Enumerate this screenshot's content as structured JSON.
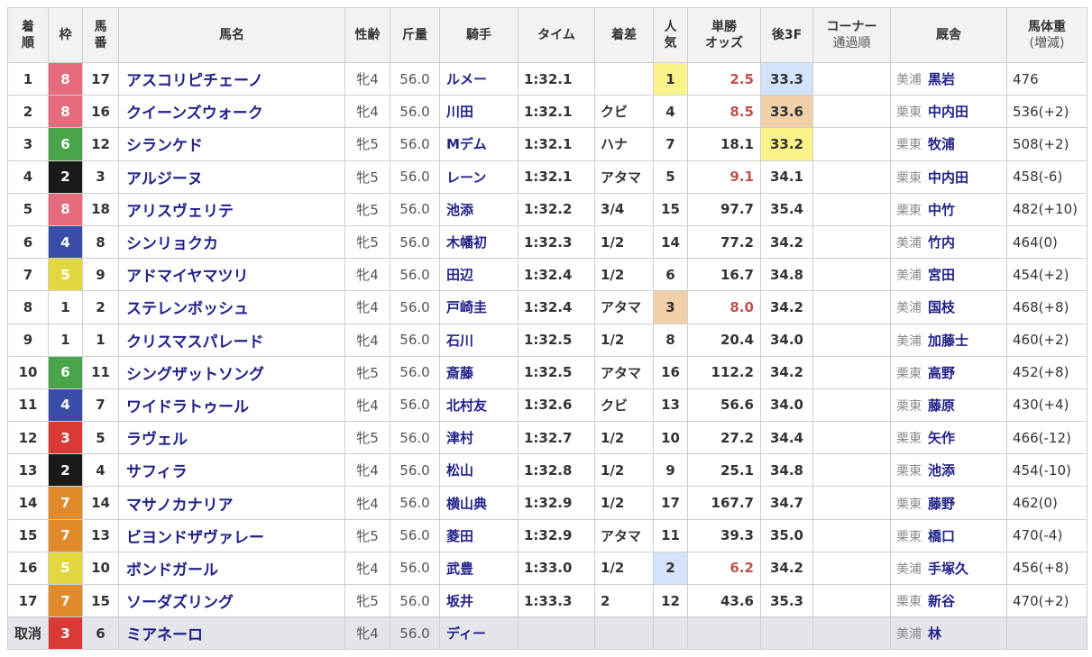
{
  "headers": {
    "rank": [
      "着",
      "順"
    ],
    "waku": "枠",
    "num": [
      "馬",
      "番"
    ],
    "name": "馬名",
    "age": "性齢",
    "weight": "斤量",
    "jockey": "騎手",
    "time": "タイム",
    "margin": "着差",
    "pop": [
      "人",
      "気"
    ],
    "odds": [
      "単勝",
      "オッズ"
    ],
    "last3f": "後3F",
    "corner": [
      "コーナー",
      "通過順"
    ],
    "stable": "厩舎",
    "bodyweight": [
      "馬体重",
      "(増減)"
    ]
  },
  "colors": {
    "waku": {
      "1": {
        "bg": "#ffffff",
        "fg": "#333333"
      },
      "2": {
        "bg": "#1a1a1a",
        "fg": "#ffffff"
      },
      "3": {
        "bg": "#d93a36",
        "fg": "#ffffff"
      },
      "4": {
        "bg": "#3b4ba8",
        "fg": "#ffffff"
      },
      "5": {
        "bg": "#e2d741",
        "fg": "#ffffff"
      },
      "6": {
        "bg": "#4aa54a",
        "fg": "#ffffff"
      },
      "7": {
        "bg": "#e08a2c",
        "fg": "#ffffff"
      },
      "8": {
        "bg": "#e56b7d",
        "fg": "#ffffff"
      }
    },
    "highlight1": "#faf38a",
    "highlight2": "#d4e2fb",
    "highlight3": "#f1cfa8"
  },
  "rows": [
    {
      "rank": "1",
      "waku": "8",
      "num": "17",
      "name": "アスコリピチェーノ",
      "age": "牝4",
      "weight": "56.0",
      "jockey": "ルメー",
      "time": "1:32.1",
      "margin": "",
      "pop": "1",
      "odds": "2.5",
      "last3f": "33.3",
      "corner": "",
      "area": "美浦",
      "trainer": "黒岩",
      "bw": "476",
      "oddsRed": true,
      "popHl": "1",
      "l3Hl": "2"
    },
    {
      "rank": "2",
      "waku": "8",
      "num": "16",
      "name": "クイーンズウォーク",
      "age": "牝4",
      "weight": "56.0",
      "jockey": "川田",
      "time": "1:32.1",
      "margin": "クビ",
      "pop": "4",
      "odds": "8.5",
      "last3f": "33.6",
      "corner": "",
      "area": "栗東",
      "trainer": "中内田",
      "bw": "536(+2)",
      "oddsRed": true,
      "popHl": "",
      "l3Hl": "3"
    },
    {
      "rank": "3",
      "waku": "6",
      "num": "12",
      "name": "シランケド",
      "age": "牝5",
      "weight": "56.0",
      "jockey": "Mデム",
      "time": "1:32.1",
      "margin": "ハナ",
      "pop": "7",
      "odds": "18.1",
      "last3f": "33.2",
      "corner": "",
      "area": "栗東",
      "trainer": "牧浦",
      "bw": "508(+2)",
      "oddsRed": false,
      "popHl": "",
      "l3Hl": "1"
    },
    {
      "rank": "4",
      "waku": "2",
      "num": "3",
      "name": "アルジーヌ",
      "age": "牝5",
      "weight": "56.0",
      "jockey": "レーン",
      "time": "1:32.1",
      "margin": "アタマ",
      "pop": "5",
      "odds": "9.1",
      "last3f": "34.1",
      "corner": "",
      "area": "栗東",
      "trainer": "中内田",
      "bw": "458(-6)",
      "oddsRed": true,
      "popHl": "",
      "l3Hl": ""
    },
    {
      "rank": "5",
      "waku": "8",
      "num": "18",
      "name": "アリスヴェリテ",
      "age": "牝5",
      "weight": "56.0",
      "jockey": "池添",
      "time": "1:32.2",
      "margin": "3/4",
      "pop": "15",
      "odds": "97.7",
      "last3f": "35.4",
      "corner": "",
      "area": "栗東",
      "trainer": "中竹",
      "bw": "482(+10)",
      "oddsRed": false,
      "popHl": "",
      "l3Hl": ""
    },
    {
      "rank": "6",
      "waku": "4",
      "num": "8",
      "name": "シンリョクカ",
      "age": "牝5",
      "weight": "56.0",
      "jockey": "木幡初",
      "time": "1:32.3",
      "margin": "1/2",
      "pop": "14",
      "odds": "77.2",
      "last3f": "34.2",
      "corner": "",
      "area": "美浦",
      "trainer": "竹内",
      "bw": "464(0)",
      "oddsRed": false,
      "popHl": "",
      "l3Hl": ""
    },
    {
      "rank": "7",
      "waku": "5",
      "num": "9",
      "name": "アドマイヤマツリ",
      "age": "牝4",
      "weight": "56.0",
      "jockey": "田辺",
      "time": "1:32.4",
      "margin": "1/2",
      "pop": "6",
      "odds": "16.7",
      "last3f": "34.8",
      "corner": "",
      "area": "美浦",
      "trainer": "宮田",
      "bw": "454(+2)",
      "oddsRed": false,
      "popHl": "",
      "l3Hl": ""
    },
    {
      "rank": "8",
      "waku": "1",
      "num": "2",
      "name": "ステレンボッシュ",
      "age": "牝4",
      "weight": "56.0",
      "jockey": "戸崎圭",
      "time": "1:32.4",
      "margin": "アタマ",
      "pop": "3",
      "odds": "8.0",
      "last3f": "34.2",
      "corner": "",
      "area": "美浦",
      "trainer": "国枝",
      "bw": "468(+8)",
      "oddsRed": true,
      "popHl": "3",
      "l3Hl": ""
    },
    {
      "rank": "9",
      "waku": "1",
      "num": "1",
      "name": "クリスマスパレード",
      "age": "牝4",
      "weight": "56.0",
      "jockey": "石川",
      "time": "1:32.5",
      "margin": "1/2",
      "pop": "8",
      "odds": "20.4",
      "last3f": "34.0",
      "corner": "",
      "area": "美浦",
      "trainer": "加藤士",
      "bw": "460(+2)",
      "oddsRed": false,
      "popHl": "",
      "l3Hl": ""
    },
    {
      "rank": "10",
      "waku": "6",
      "num": "11",
      "name": "シングザットソング",
      "age": "牝5",
      "weight": "56.0",
      "jockey": "斎藤",
      "time": "1:32.5",
      "margin": "アタマ",
      "pop": "16",
      "odds": "112.2",
      "last3f": "34.2",
      "corner": "",
      "area": "栗東",
      "trainer": "高野",
      "bw": "452(+8)",
      "oddsRed": false,
      "popHl": "",
      "l3Hl": ""
    },
    {
      "rank": "11",
      "waku": "4",
      "num": "7",
      "name": "ワイドラトゥール",
      "age": "牝4",
      "weight": "56.0",
      "jockey": "北村友",
      "time": "1:32.6",
      "margin": "クビ",
      "pop": "13",
      "odds": "56.6",
      "last3f": "34.0",
      "corner": "",
      "area": "栗東",
      "trainer": "藤原",
      "bw": "430(+4)",
      "oddsRed": false,
      "popHl": "",
      "l3Hl": ""
    },
    {
      "rank": "12",
      "waku": "3",
      "num": "5",
      "name": "ラヴェル",
      "age": "牝5",
      "weight": "56.0",
      "jockey": "津村",
      "time": "1:32.7",
      "margin": "1/2",
      "pop": "10",
      "odds": "27.2",
      "last3f": "34.4",
      "corner": "",
      "area": "栗東",
      "trainer": "矢作",
      "bw": "466(-12)",
      "oddsRed": false,
      "popHl": "",
      "l3Hl": ""
    },
    {
      "rank": "13",
      "waku": "2",
      "num": "4",
      "name": "サフィラ",
      "age": "牝4",
      "weight": "56.0",
      "jockey": "松山",
      "time": "1:32.8",
      "margin": "1/2",
      "pop": "9",
      "odds": "25.1",
      "last3f": "34.8",
      "corner": "",
      "area": "栗東",
      "trainer": "池添",
      "bw": "454(-10)",
      "oddsRed": false,
      "popHl": "",
      "l3Hl": ""
    },
    {
      "rank": "14",
      "waku": "7",
      "num": "14",
      "name": "マサノカナリア",
      "age": "牝4",
      "weight": "56.0",
      "jockey": "横山典",
      "time": "1:32.9",
      "margin": "1/2",
      "pop": "17",
      "odds": "167.7",
      "last3f": "34.7",
      "corner": "",
      "area": "栗東",
      "trainer": "藤野",
      "bw": "462(0)",
      "oddsRed": false,
      "popHl": "",
      "l3Hl": ""
    },
    {
      "rank": "15",
      "waku": "7",
      "num": "13",
      "name": "ビヨンドザヴァレー",
      "age": "牝5",
      "weight": "56.0",
      "jockey": "菱田",
      "time": "1:32.9",
      "margin": "アタマ",
      "pop": "11",
      "odds": "39.3",
      "last3f": "35.0",
      "corner": "",
      "area": "栗東",
      "trainer": "橋口",
      "bw": "470(-4)",
      "oddsRed": false,
      "popHl": "",
      "l3Hl": ""
    },
    {
      "rank": "16",
      "waku": "5",
      "num": "10",
      "name": "ボンドガール",
      "age": "牝4",
      "weight": "56.0",
      "jockey": "武豊",
      "time": "1:33.0",
      "margin": "1/2",
      "pop": "2",
      "odds": "6.2",
      "last3f": "34.2",
      "corner": "",
      "area": "美浦",
      "trainer": "手塚久",
      "bw": "456(+8)",
      "oddsRed": true,
      "popHl": "2",
      "l3Hl": ""
    },
    {
      "rank": "17",
      "waku": "7",
      "num": "15",
      "name": "ソーダズリング",
      "age": "牝5",
      "weight": "56.0",
      "jockey": "坂井",
      "time": "1:33.3",
      "margin": "2",
      "pop": "12",
      "odds": "43.6",
      "last3f": "35.3",
      "corner": "",
      "area": "栗東",
      "trainer": "新谷",
      "bw": "470(+2)",
      "oddsRed": false,
      "popHl": "",
      "l3Hl": ""
    },
    {
      "rank": "取消",
      "waku": "3",
      "num": "6",
      "name": "ミアネーロ",
      "age": "牝4",
      "weight": "56.0",
      "jockey": "ディー",
      "time": "",
      "margin": "",
      "pop": "",
      "odds": "",
      "last3f": "",
      "corner": "",
      "area": "美浦",
      "trainer": "林",
      "bw": "",
      "oddsRed": false,
      "popHl": "",
      "l3Hl": "",
      "scratched": true
    }
  ]
}
